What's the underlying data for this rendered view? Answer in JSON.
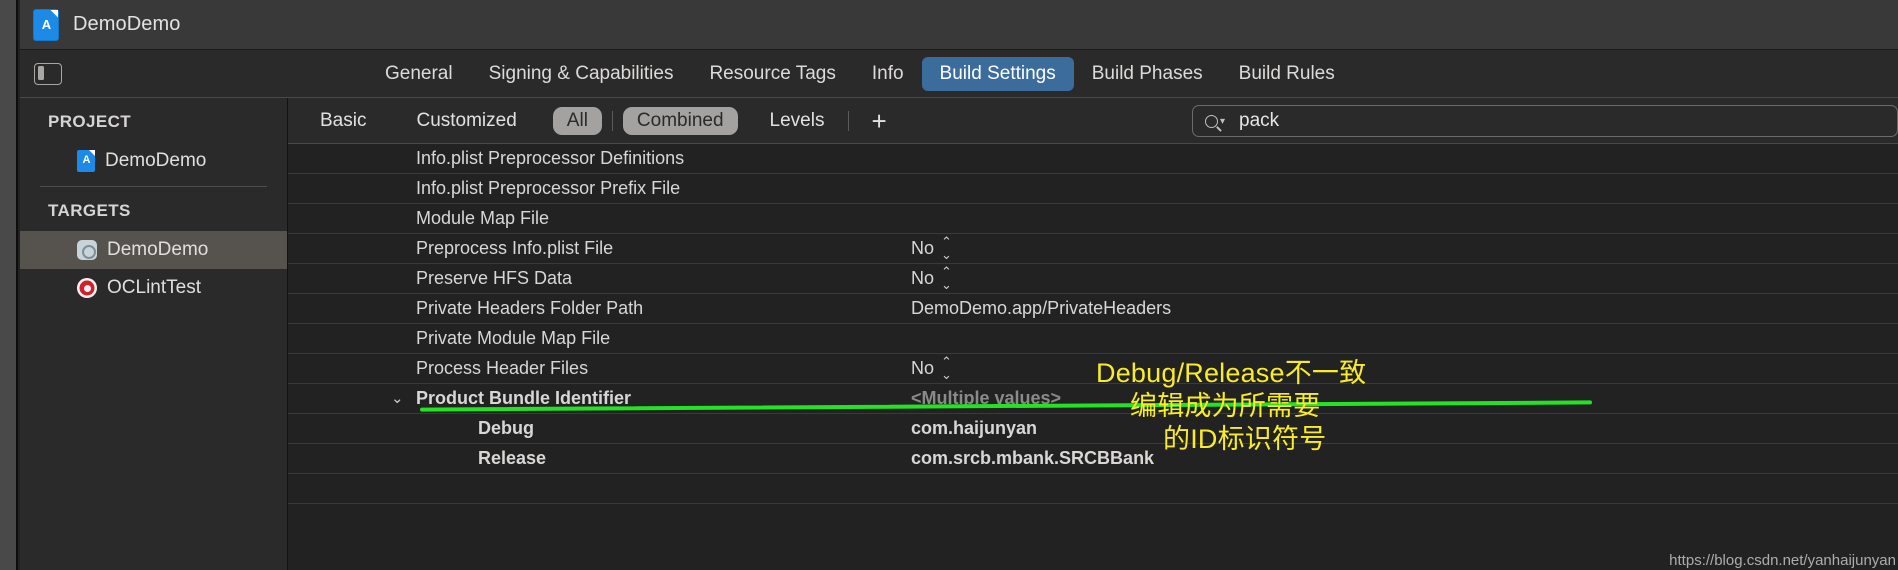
{
  "window": {
    "title": "DemoDemo",
    "icon": "xcode-project-icon"
  },
  "tabbar": {
    "pane_toggle_icon": "navigator-pane-toggle-icon",
    "tabs": [
      {
        "label": "General",
        "selected": false
      },
      {
        "label": "Signing & Capabilities",
        "selected": false
      },
      {
        "label": "Resource Tags",
        "selected": false
      },
      {
        "label": "Info",
        "selected": false
      },
      {
        "label": "Build Settings",
        "selected": true
      },
      {
        "label": "Build Phases",
        "selected": false
      },
      {
        "label": "Build Rules",
        "selected": false
      }
    ]
  },
  "sidebar": {
    "project_group_label": "PROJECT",
    "targets_group_label": "TARGETS",
    "project_items": [
      {
        "label": "DemoDemo",
        "icon": "xcode-project-icon",
        "selected": false
      }
    ],
    "target_items": [
      {
        "label": "DemoDemo",
        "icon": "app-target-icon",
        "selected": true
      },
      {
        "label": "OCLintTest",
        "icon": "bullseye-target-icon",
        "selected": false
      }
    ]
  },
  "filterbar": {
    "basic_label": "Basic",
    "customized_label": "Customized",
    "all_label": "All",
    "combined_label": "Combined",
    "levels_label": "Levels",
    "add_label": "+",
    "search": {
      "value": "pack",
      "placeholder": "Search",
      "icon": "search-icon"
    }
  },
  "settings_table": {
    "rows": [
      {
        "name": "Info.plist Preprocessor Definitions",
        "value": "",
        "type": "plain"
      },
      {
        "name": "Info.plist Preprocessor Prefix File",
        "value": "",
        "type": "plain"
      },
      {
        "name": "Module Map File",
        "value": "",
        "type": "plain"
      },
      {
        "name": "Preprocess Info.plist File",
        "value": "No",
        "type": "stepper"
      },
      {
        "name": "Preserve HFS Data",
        "value": "No",
        "type": "stepper"
      },
      {
        "name": "Private Headers Folder Path",
        "value": "DemoDemo.app/PrivateHeaders",
        "type": "plain"
      },
      {
        "name": "Private Module Map File",
        "value": "",
        "type": "plain"
      },
      {
        "name": "Process Header Files",
        "value": "No",
        "type": "stepper"
      },
      {
        "name": "Product Bundle Identifier",
        "value": "<Multiple values>",
        "type": "group",
        "disclosure": "chevron-down-icon"
      },
      {
        "name": "Debug",
        "value": "com.haijunyan",
        "type": "sub"
      },
      {
        "name": "Release",
        "value": "com.srcb.mbank.SRCBBank",
        "type": "sub"
      }
    ]
  },
  "annotations": {
    "line_color": "#22e422",
    "text_color": "#f8ec26",
    "note_line_1": "Debug/Release不一致",
    "note_line_2": "编辑成为所需要",
    "note_line_3": "的ID标识符号",
    "watermark": "https://blog.csdn.net/yanhaijunyan"
  }
}
